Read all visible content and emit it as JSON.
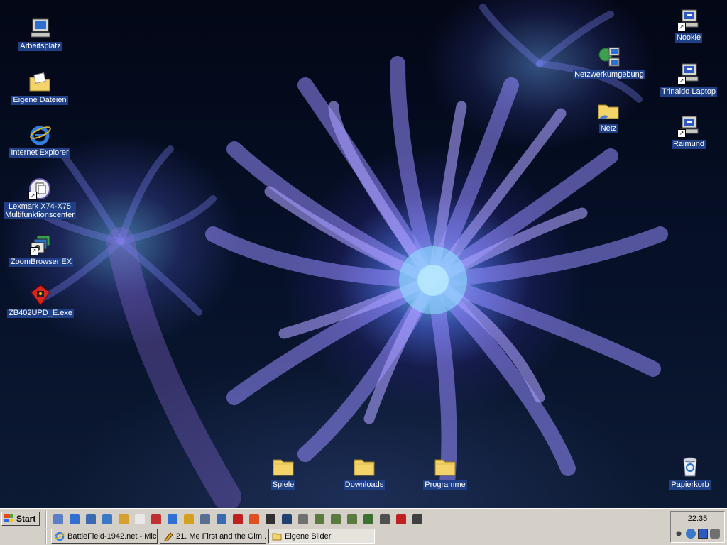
{
  "desktop": {
    "left_icons": [
      {
        "label": "Arbeitsplatz",
        "icon": "computer-icon"
      },
      {
        "label": "Eigene Dateien",
        "icon": "documents-folder-icon"
      },
      {
        "label": "Internet Explorer",
        "icon": "internet-explorer-icon"
      },
      {
        "label": "Lexmark X74-X75 Multifunktionscenter",
        "label_line1": "Lexmark X74-X75",
        "label_line2": "Multifunktionscenter",
        "icon": "lexmark-icon"
      },
      {
        "label": "ZoomBrowser EX",
        "icon": "zoombrowser-icon"
      },
      {
        "label": "ZB402UPD_E.exe",
        "icon": "installer-icon"
      }
    ],
    "right_icons": [
      {
        "label": "Nookie",
        "icon": "network-computer-icon"
      },
      {
        "label": "Netzwerkumgebung",
        "icon": "network-places-icon"
      },
      {
        "label": "Trinaldo Laptop",
        "icon": "network-computer-icon"
      },
      {
        "label": "Netz",
        "icon": "shared-folder-icon"
      },
      {
        "label": "Raimund",
        "icon": "network-computer-icon"
      },
      {
        "label": "Papierkorb",
        "icon": "recycle-bin-icon"
      }
    ],
    "bottom_icons": [
      {
        "label": "Spiele",
        "icon": "folder-icon"
      },
      {
        "label": "Downloads",
        "icon": "folder-icon"
      },
      {
        "label": "Programme",
        "icon": "folder-icon"
      }
    ]
  },
  "taskbar": {
    "start_label": "Start",
    "quick_launch": [
      {
        "icon": "show-desktop-icon",
        "color": "#5a7fc7"
      },
      {
        "icon": "internet-explorer-icon",
        "color": "#2f6fd6"
      },
      {
        "icon": "network-icon",
        "color": "#3a6ab0"
      },
      {
        "icon": "phone-icon",
        "color": "#3a78c8"
      },
      {
        "icon": "pencil-icon",
        "color": "#d6a030"
      },
      {
        "icon": "document-icon",
        "color": "#e8e8e8"
      },
      {
        "icon": "player-icon",
        "color": "#c03030"
      },
      {
        "icon": "messenger-icon",
        "color": "#2f6fd6"
      },
      {
        "icon": "key-icon",
        "color": "#d4a020"
      },
      {
        "icon": "pc-icon",
        "color": "#5a6e90"
      },
      {
        "icon": "ftp-icon",
        "color": "#3c6ab0"
      },
      {
        "icon": "media-icon",
        "color": "#c02020"
      },
      {
        "icon": "burn-icon",
        "color": "#e05020"
      },
      {
        "icon": "headphones-icon",
        "color": "#303030"
      },
      {
        "icon": "terminal-icon",
        "color": "#204070"
      },
      {
        "icon": "settings-icon",
        "color": "#707070"
      },
      {
        "icon": "tank-icon",
        "color": "#5a7a40"
      },
      {
        "icon": "tank-icon",
        "color": "#5a7a40"
      },
      {
        "icon": "tank-icon",
        "color": "#5a7a40"
      },
      {
        "icon": "game-icon",
        "color": "#3a7030"
      },
      {
        "icon": "camera-icon",
        "color": "#505050"
      },
      {
        "icon": "record-icon",
        "color": "#c02020"
      },
      {
        "icon": "speaker-icon",
        "color": "#404040"
      }
    ],
    "tasks": [
      {
        "label": "BattleField-1942.net - Mic...",
        "icon": "internet-explorer-icon",
        "pressed": false
      },
      {
        "label": "21. Me First and the Gim...",
        "icon": "winamp-icon",
        "pressed": false
      },
      {
        "label": "Eigene Bilder",
        "icon": "folder-icon",
        "pressed": true
      }
    ],
    "clock": "22:35",
    "tray_icons": [
      "volume-icon",
      "network-icon",
      "monitor-icon",
      "connection-icon"
    ]
  },
  "colors": {
    "label_background": "#1f3f86",
    "taskbar": "#d4d0c8"
  }
}
